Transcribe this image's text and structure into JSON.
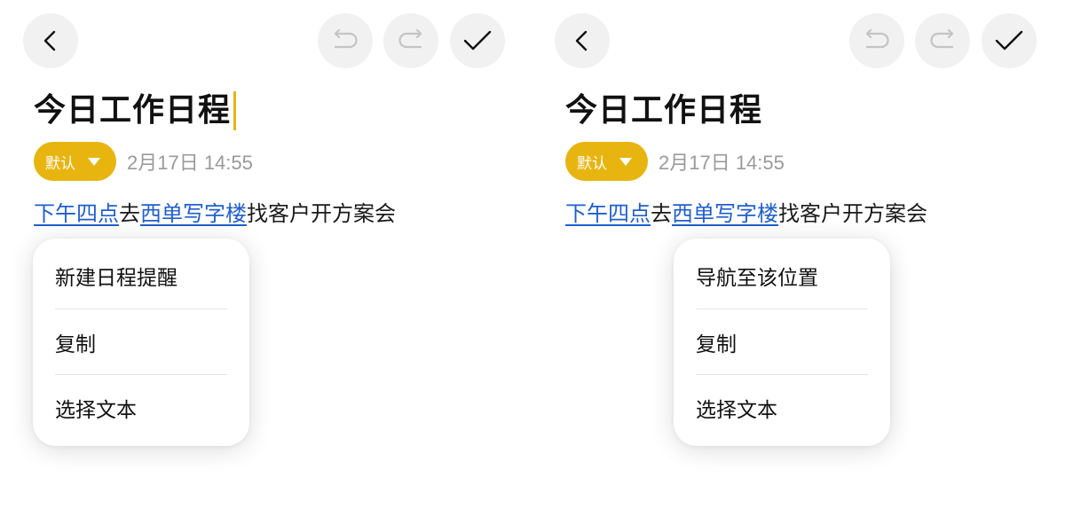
{
  "left_screen": {
    "title": "今日工作日程",
    "category": "默认",
    "date": "2月17日 14:55",
    "body": {
      "link_time": "下午四点",
      "text_1": "去",
      "link_place": "西单写字楼",
      "text_2": "找客户开方案会"
    },
    "menu": {
      "item_1": "新建日程提醒",
      "item_2": "复制",
      "item_3": "选择文本"
    }
  },
  "right_screen": {
    "title": "今日工作日程",
    "category": "默认",
    "date": "2月17日 14:55",
    "body": {
      "link_time": "下午四点",
      "text_1": "去",
      "link_place": "西单写字楼",
      "text_2": "找客户开方案会"
    },
    "menu": {
      "item_1": "导航至该位置",
      "item_2": "复制",
      "item_3": "选择文本"
    }
  },
  "toolbar": {
    "back_icon": "chevron-left-icon",
    "undo_icon": "undo-icon",
    "redo_icon": "redo-icon",
    "done_icon": "checkmark-icon"
  },
  "colors": {
    "accent": "#e8b510",
    "link": "#1f5fcf",
    "button_bg": "#f1f1f1",
    "disabled_icon": "#c4c4c4"
  }
}
